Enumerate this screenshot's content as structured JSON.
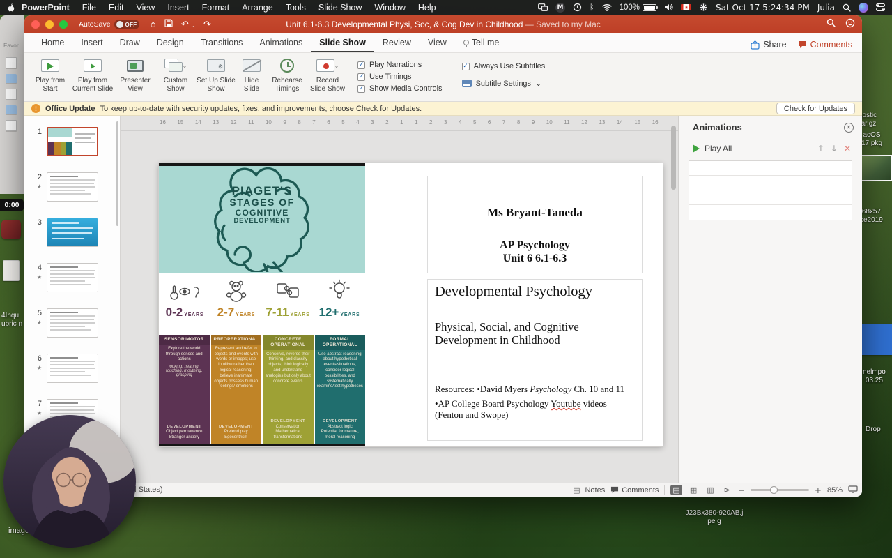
{
  "menubar": {
    "items": [
      "PowerPoint",
      "File",
      "Edit",
      "View",
      "Insert",
      "Format",
      "Arrange",
      "Tools",
      "Slide Show",
      "Window",
      "Help"
    ],
    "battery": "100%",
    "time": "Sat Oct 17 5:24:34 PM",
    "user": "Julia"
  },
  "window": {
    "titlebar": {
      "autosave_label": "AutoSave",
      "autosave_state": "OFF",
      "title": "Unit 6.1-6.3 Developmental Physi, Soc, & Cog Dev in Childhood",
      "saved_status": " — Saved to my Mac"
    },
    "tabs": [
      "Home",
      "Insert",
      "Draw",
      "Design",
      "Transitions",
      "Animations",
      "Slide Show",
      "Review",
      "View",
      "Tell me"
    ],
    "active_tab": "Slide Show",
    "share_label": "Share",
    "comments_label": "Comments",
    "ribbon": {
      "buttons": [
        "Play from Start",
        "Play from Current Slide",
        "Presenter View",
        "Custom Show",
        "Set Up Slide Show",
        "Hide Slide",
        "Rehearse Timings",
        "Record Slide Show"
      ],
      "checks": [
        "Play Narrations",
        "Use Timings",
        "Show Media Controls"
      ],
      "subtitle_check": "Always Use Subtitles",
      "subtitle_settings": "Subtitle Settings"
    },
    "update_bar": {
      "title": "Office Update",
      "message": "To keep up-to-date with security updates, fixes, and improvements, choose Check for Updates.",
      "button_label": "Check for Updates"
    },
    "slides_panel": {
      "timer": "0:00",
      "slides": [
        {
          "n": "1",
          "starred": false,
          "kind": "title",
          "selected": true
        },
        {
          "n": "2",
          "starred": true,
          "kind": "text",
          "selected": false
        },
        {
          "n": "3",
          "starred": false,
          "kind": "blue",
          "selected": false
        },
        {
          "n": "4",
          "starred": true,
          "kind": "text",
          "selected": false
        },
        {
          "n": "5",
          "starred": true,
          "kind": "text",
          "selected": false
        },
        {
          "n": "6",
          "starred": true,
          "kind": "text",
          "selected": false
        },
        {
          "n": "7",
          "starred": true,
          "kind": "text",
          "selected": false
        }
      ]
    },
    "ruler_numbers": [
      "16",
      "15",
      "14",
      "13",
      "12",
      "11",
      "10",
      "9",
      "8",
      "7",
      "6",
      "5",
      "4",
      "3",
      "2",
      "1",
      "1",
      "2",
      "3",
      "4",
      "5",
      "6",
      "7",
      "8",
      "9",
      "10",
      "11",
      "12",
      "13",
      "14",
      "15",
      "16"
    ],
    "animations_pane": {
      "title": "Animations",
      "play_all_label": "Play All"
    },
    "statusbar": {
      "language": "English (United States)",
      "notes_label": "Notes",
      "comments_label": "Comments",
      "zoom_percent": "85%"
    }
  },
  "slide": {
    "infographic": {
      "title_lines": [
        "PIAGET'S",
        "STAGES OF",
        "COGNITIVE",
        "DEVELOPMENT"
      ],
      "years_suffix": "YEARS",
      "stages": [
        {
          "age": "0-2",
          "name": "SENSORIMOTOR",
          "color": "#5c3353",
          "desc": "Explore the world through senses and actions",
          "examples": "looking, hearing, touching, mouthing, grasping",
          "dev_label": "DEVELOPMENT",
          "dev_lines": [
            "Object permanence",
            "Stranger anxiety"
          ]
        },
        {
          "age": "2-7",
          "name": "PREOPERATIONAL",
          "color": "#c08427",
          "desc": "Represent and refer to objects and events with words or images; use intuitive rather than logical reasoning; believe inanimate objects possess human feelings/ emotions",
          "examples": "",
          "dev_label": "DEVELOPMENT",
          "dev_lines": [
            "Pretend play",
            "Egocentrism"
          ]
        },
        {
          "age": "7-11",
          "name": "CONCRETE OPERATIONAL",
          "color": "#9ea135",
          "desc": "Conserve, reverse their thinking, and classify objects; think logically and understand analogies but only about concrete events",
          "examples": "",
          "dev_label": "DEVELOPMENT",
          "dev_lines": [
            "Conservation",
            "Mathematical transformations"
          ]
        },
        {
          "age": "12+",
          "name": "FORMAL OPERATIONAL",
          "color": "#206e6e",
          "desc": "Use abstract reasoning about hypothetical events/situations, consider logical possibilities, and systematically examine/test hypotheses",
          "examples": "",
          "dev_label": "DEVELOPMENT",
          "dev_lines": [
            "Abstract logic",
            "Potential for mature, moral reasoning"
          ]
        }
      ]
    },
    "textbox_top": {
      "author": "Ms Bryant-Taneda",
      "course": "AP Psychology",
      "unit": "Unit 6 6.1-6.3"
    },
    "textbox_main": {
      "title": "Developmental Psychology",
      "subtitle": "Physical, Social, and Cognitive Development in Childhood",
      "res1_pre": "Resources: •David Myers ",
      "res1_italic": "Psychology",
      "res1_post": " Ch. 10 and 11",
      "res2_pre": "•AP College Board Psychology ",
      "res2_underline": "Youtube",
      "res2_post": " videos (Fenton and Swope)"
    }
  },
  "desktop": {
    "icon_labels": [
      [
        "nostic",
        "tar.gz"
      ],
      [
        "acOS",
        "17.pkg"
      ],
      [
        "68x57",
        "ce2019"
      ],
      [
        "nelmpo",
        "03.25"
      ],
      [
        "Drop"
      ],
      [
        "J23Bx380-920AB.j",
        "pe g"
      ]
    ],
    "images_label": "images.",
    "left_labels": [
      "4Inqu",
      "ubric n"
    ],
    "favorites_label": "Favor"
  },
  "brand": {
    "titlebar_color": "#c2452c"
  }
}
